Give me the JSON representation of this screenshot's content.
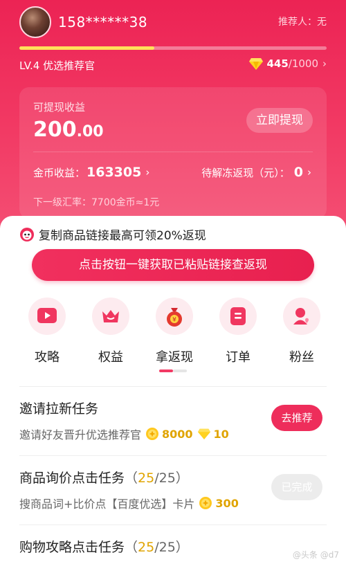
{
  "header": {
    "phone": "158******38",
    "referrer": "推荐人：无",
    "level_label": "LV.4 优选推荐官",
    "level_progress": 0.44,
    "gems_current": "445",
    "gems_total": "/1000",
    "chevron": "›"
  },
  "earnings": {
    "title": "可提现收益",
    "amount_int": "200",
    "amount_dec": ".00",
    "withdraw_label": "立即提现",
    "coin_label": "金币收益：",
    "coin_value": "163305",
    "frozen_label": "待解冻返现（元）：",
    "frozen_value": "0",
    "rate_text": "下一级汇率：7700金币≈1元"
  },
  "copy_tip": "复制商品链接最高可领20%返现",
  "cta_label": "点击按钮一键获取已粘贴链接查返现",
  "shortcuts": [
    {
      "label": "攻略",
      "icon": "play-icon"
    },
    {
      "label": "权益",
      "icon": "crown-icon"
    },
    {
      "label": "拿返现",
      "icon": "money-bag-icon"
    },
    {
      "label": "订单",
      "icon": "order-icon"
    },
    {
      "label": "粉丝",
      "icon": "fans-icon"
    }
  ],
  "tasks": [
    {
      "title": "邀请拉新任务",
      "desc": "邀请好友晋升优选推荐官",
      "coins": "8000",
      "gems": "10",
      "button": "去推荐"
    },
    {
      "title": "商品询价点击任务",
      "progress": "25",
      "progress_total": "/25）",
      "progress_open": "（",
      "desc": "搜商品词+比价点【百度优选】卡片",
      "coins": "300",
      "button": "已完成"
    },
    {
      "title": "购物攻略点击任务",
      "progress": "25",
      "progress_total": "/25）",
      "progress_open": "（"
    }
  ],
  "watermark": "@头条 @d7",
  "colors": {
    "brand": "#ee2d5b",
    "gold": "#e0a400"
  }
}
